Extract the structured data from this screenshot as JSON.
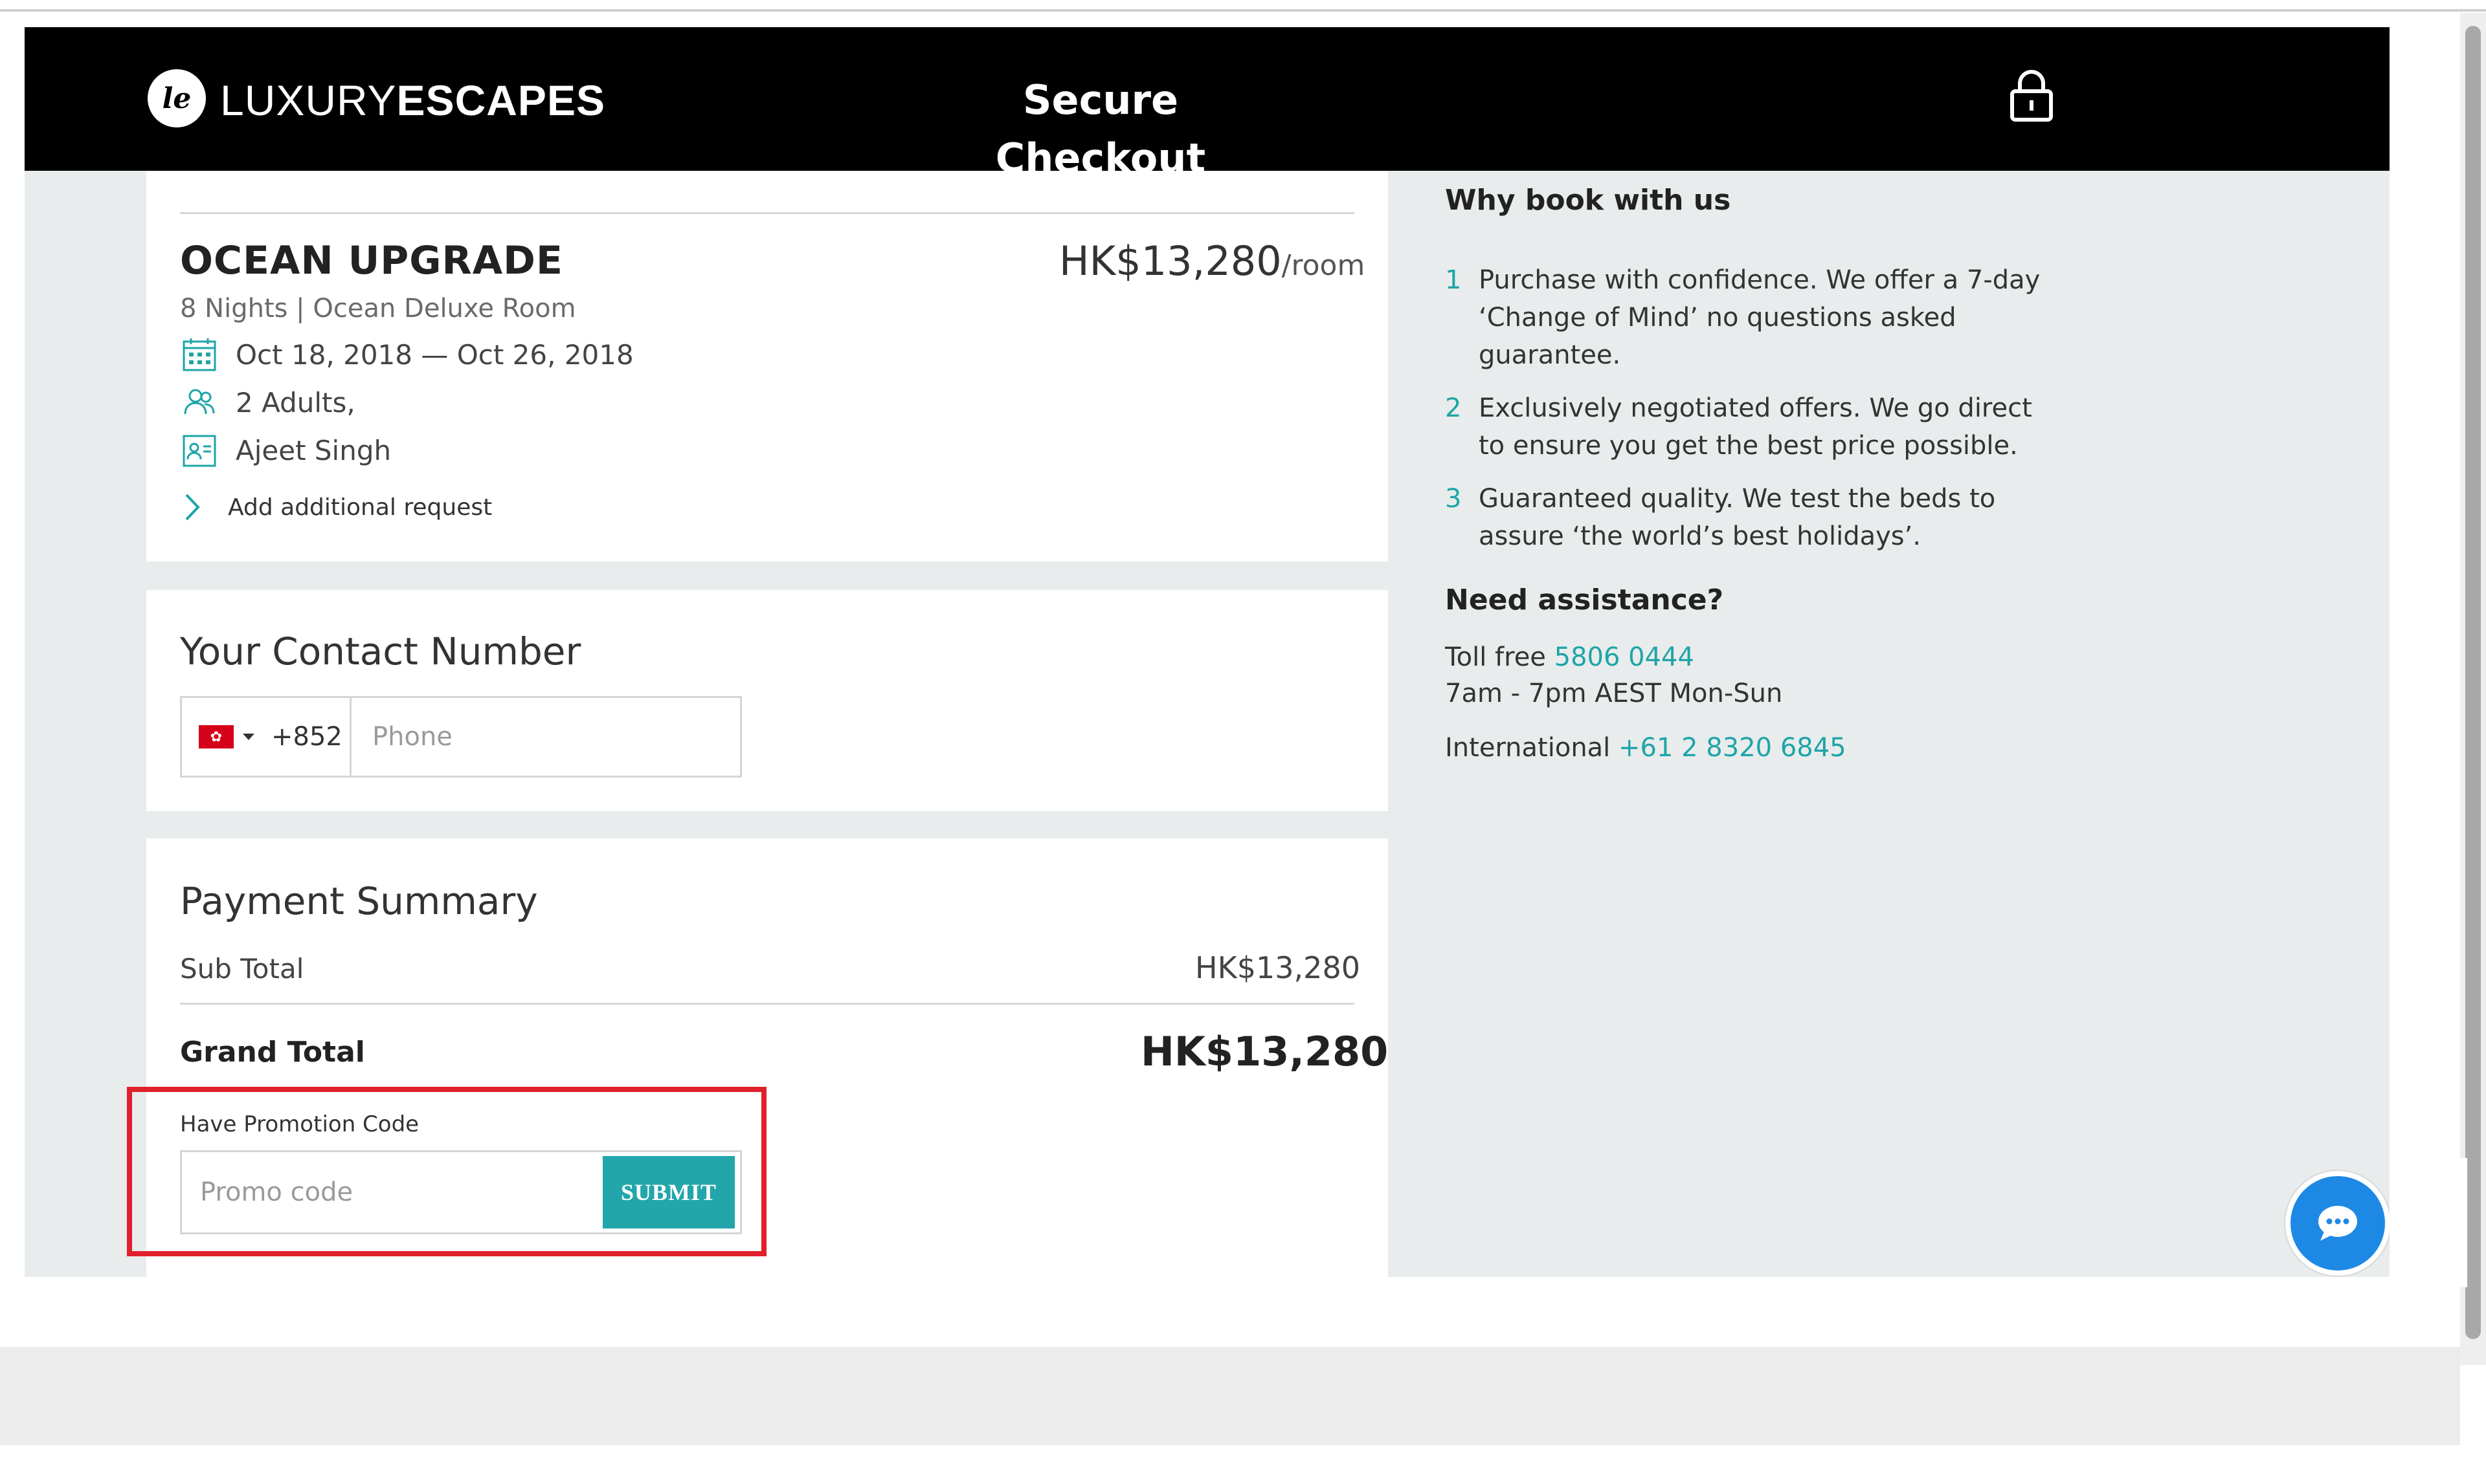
{
  "header": {
    "logo_thin": "LUXURY",
    "logo_bold": "ESCAPES",
    "title": "Secure Checkout"
  },
  "booking": {
    "title": "OCEAN UPGRADE",
    "price": "HK$13,280",
    "price_unit": "/room",
    "subtitle": "8 Nights | Ocean Deluxe Room",
    "dates": "Oct 18, 2018 — Oct 26, 2018",
    "guests": "2 Adults,",
    "guest_name": "Ajeet Singh",
    "add_request": "Add additional request"
  },
  "contact": {
    "title": "Your Contact Number",
    "dial_code": "+852",
    "phone_placeholder": "Phone",
    "phone_value": ""
  },
  "payment": {
    "title": "Payment Summary",
    "subtotal_label": "Sub Total",
    "subtotal_value": "HK$13,280",
    "grand_label": "Grand Total",
    "grand_value": "HK$13,280",
    "promo_label": "Have Promotion Code",
    "promo_placeholder": "Promo code",
    "promo_value": "",
    "submit_label": "SUBMIT"
  },
  "sidebar": {
    "why_title": "Why book with us",
    "reasons": [
      {
        "num": "1",
        "text": "Purchase with confidence. We offer a 7-day ‘Change of Mind’ no questions asked guarantee."
      },
      {
        "num": "2",
        "text": "Exclusively negotiated offers. We go direct to ensure you get the best price possible."
      },
      {
        "num": "3",
        "text": "Guaranteed quality. We test the beds to assure ‘the world’s best holidays’."
      }
    ],
    "assist_title": "Need assistance?",
    "toll_free_label": "Toll free",
    "toll_free_number": "5806 0444",
    "hours": "7am - 7pm AEST Mon-Sun",
    "international_label": "International",
    "international_number": "+61 2 8320 6845"
  },
  "colors": {
    "accent_teal": "#22a6ab",
    "header_bg": "#000000",
    "highlight_red": "#e0202c",
    "chat_blue": "#1e88e5"
  },
  "icons": [
    "lock-icon",
    "calendar-icon",
    "guests-icon",
    "contact-card-icon",
    "chevron-right-icon",
    "hk-flag-icon",
    "chat-icon"
  ]
}
